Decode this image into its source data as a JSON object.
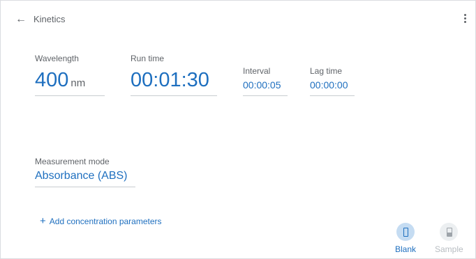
{
  "header": {
    "title": "Kinetics"
  },
  "fields": {
    "wavelength": {
      "label": "Wavelength",
      "value": "400",
      "unit": "nm"
    },
    "run_time": {
      "label": "Run time",
      "value": "00:01:30"
    },
    "interval": {
      "label": "Interval",
      "value": "00:00:05"
    },
    "lag_time": {
      "label": "Lag time",
      "value": "00:00:00"
    },
    "measurement_mode": {
      "label": "Measurement mode",
      "value": "Absorbance (ABS)"
    }
  },
  "actions": {
    "add_concentration": "Add concentration parameters",
    "blank": "Blank",
    "sample": "Sample"
  },
  "colors": {
    "accent": "#1e6fbf",
    "text": "#5f6368",
    "disabled": "#b8bdc2"
  },
  "icons": {
    "back": "arrow-left-icon",
    "more": "more-vert-icon",
    "blank": "cuvette-empty-icon",
    "sample": "cuvette-filled-icon"
  }
}
